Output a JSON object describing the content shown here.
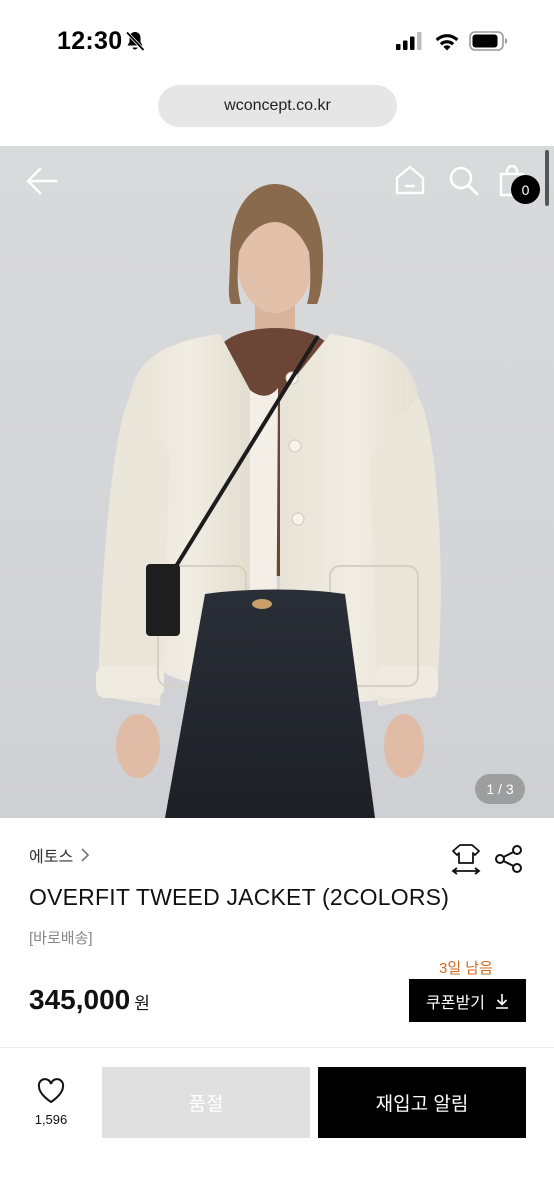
{
  "status_bar": {
    "time": "12:30",
    "icons": [
      "bell-slash-icon",
      "signal-icon",
      "wifi-icon",
      "battery-icon"
    ]
  },
  "browser": {
    "url": "wconcept.co.kr"
  },
  "header": {
    "icons": [
      "back-arrow-icon",
      "home-icon",
      "search-icon",
      "shopping-bag-icon"
    ],
    "cart_count": "0"
  },
  "gallery": {
    "page_indicator": "1 / 3"
  },
  "product": {
    "brand": "에토스",
    "title": "OVERFIT TWEED JACKET (2COLORS)",
    "delivery_tag": "[바로배송]",
    "days_left": "3일 남음",
    "price": "345,000",
    "price_unit": "원",
    "coupon_label": "쿠폰받기",
    "icons": [
      "size-guide-icon",
      "share-icon",
      "chevron-right-icon",
      "download-icon"
    ]
  },
  "bottom_bar": {
    "wish_count": "1,596",
    "soldout_label": "품절",
    "restock_label": "재입고 알림"
  },
  "colors": {
    "accent_orange": "#d2691e",
    "black": "#000000",
    "soldout_gray": "#e0e0e0"
  }
}
